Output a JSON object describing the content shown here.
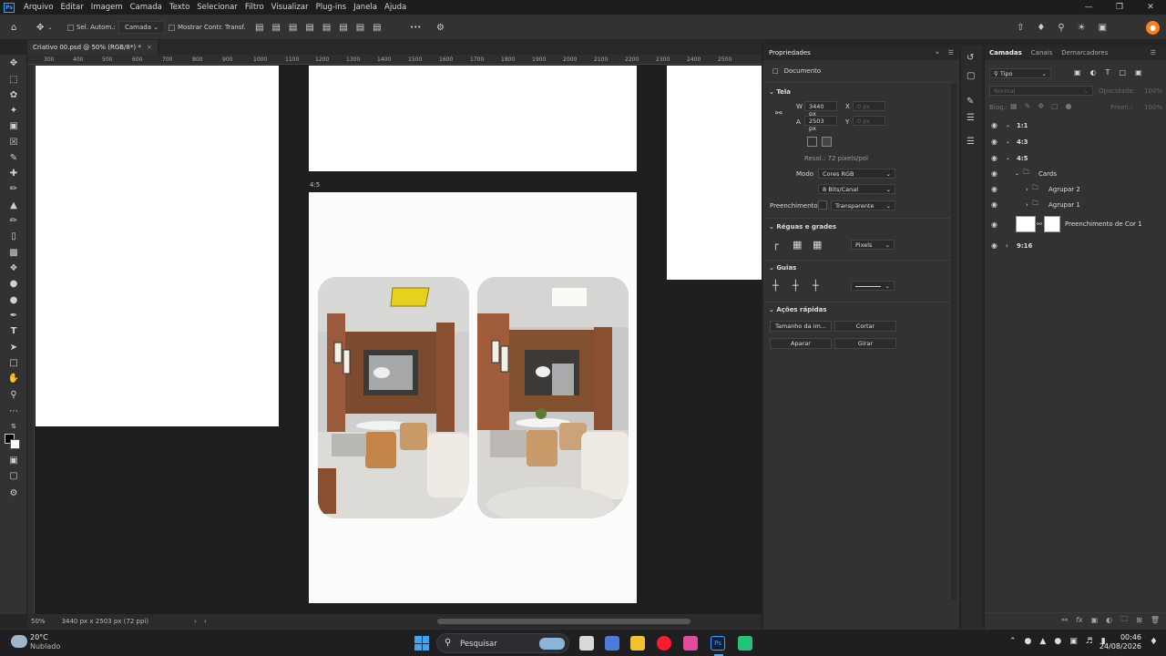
{
  "menu": [
    "Arquivo",
    "Editar",
    "Imagem",
    "Camada",
    "Texto",
    "Selecionar",
    "Filtro",
    "Visualizar",
    "Plug-ins",
    "Janela",
    "Ajuda"
  ],
  "app_logo": "Ps",
  "options": {
    "auto_select_label": "Sel. Autom.:",
    "auto_select_value": "Camada",
    "show_transform_label": "Mostrar Contr. Transf.",
    "more": "•••"
  },
  "document": {
    "tab_title": "Criativo 00.psd @ 50% (RGB/8*) *",
    "zoom": "50%",
    "dimensions": "3440 px x 2503 px (72 ppi)",
    "ruler_ticks": [
      "300",
      "400",
      "500",
      "600",
      "700",
      "800",
      "900",
      "1000",
      "1100",
      "1200",
      "1300",
      "1400",
      "1500",
      "1600",
      "1700",
      "1800",
      "1900",
      "2000",
      "2100",
      "2200",
      "2300",
      "2400",
      "2500"
    ],
    "artboard_label_45": "4:5"
  },
  "properties": {
    "title": "Propriedades",
    "type": "Documento",
    "canvas_section": "Tela",
    "w_label": "W",
    "w_value": "3440 px",
    "h_label": "A",
    "h_value": "2503 px",
    "x_label": "X",
    "x_placeholder": "0 px",
    "y_label": "Y",
    "y_placeholder": "0 px",
    "resolution": "Resol.: 72 pixels/pol",
    "mode_label": "Modo",
    "mode_value": "Cores RGB",
    "bits_value": "8 Bits/Canal",
    "fill_label": "Preenchimento",
    "fill_value": "Transparente",
    "rulers_section": "Réguas e grades",
    "units_value": "Pixels",
    "guides_section": "Guias",
    "quick_actions_section": "Ações rápidas",
    "btn_image_size": "Tamanho da im...",
    "btn_crop": "Cortar",
    "btn_trim": "Aparar",
    "btn_rotate": "Girar"
  },
  "layers": {
    "tabs": [
      "Camadas",
      "Canais",
      "Demarcadores"
    ],
    "filter_kind": "Tipo",
    "blend_mode": "Normal",
    "opacity_label": "Opacidade:",
    "opacity_value": "100%",
    "lock_label": "Bloq.:",
    "fill_label": "Preen.:",
    "fill_value": "100%",
    "rows": [
      {
        "name": "1:1"
      },
      {
        "name": "4:3"
      },
      {
        "name": "4:5"
      },
      {
        "name": "Cards"
      },
      {
        "name": "Agrupar 2"
      },
      {
        "name": "Agrupar 1"
      },
      {
        "name": "Preenchimento de Cor 1"
      },
      {
        "name": "9:16"
      }
    ]
  },
  "taskbar": {
    "temperature": "20°C",
    "weather": "Nublado",
    "search_placeholder": "Pesquisar",
    "time": "00:46",
    "date": "24/08/2026"
  },
  "colors": {
    "accent_ps": "#31a8ff",
    "canvas_bg": "#1e1e1e",
    "panel_bg": "#323232",
    "update_badge": "#ff7e1a"
  }
}
